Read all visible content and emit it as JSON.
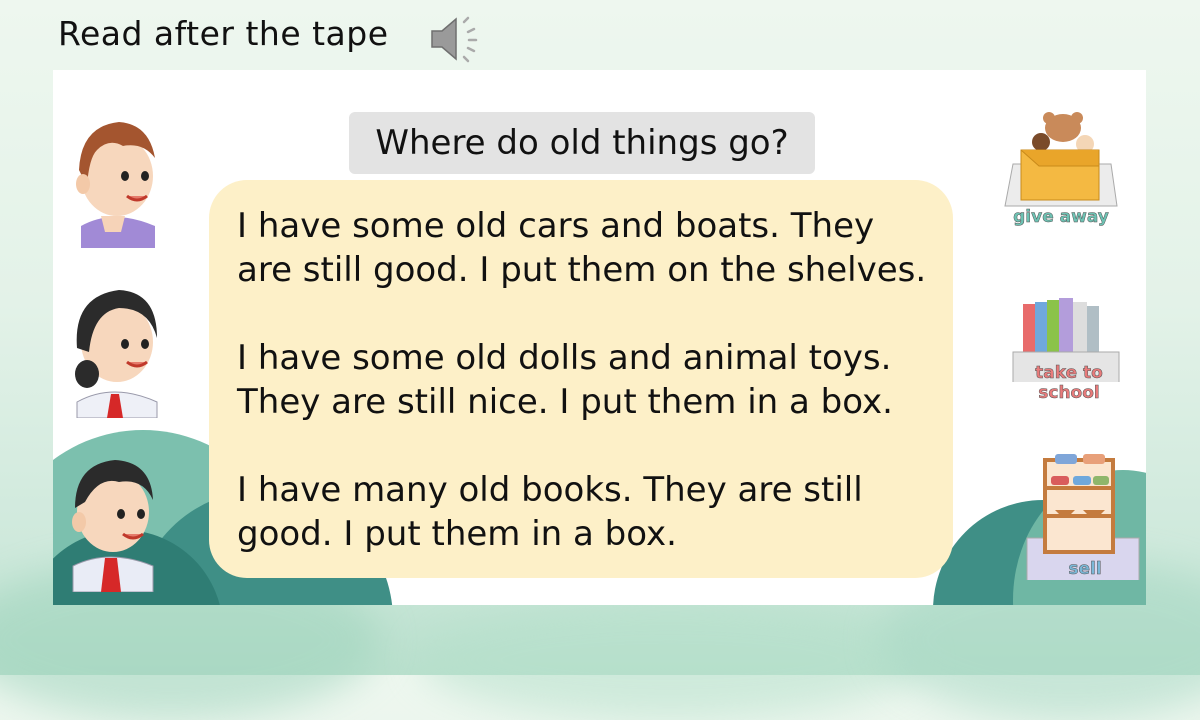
{
  "header": {
    "title": "Read after the tape"
  },
  "icons": {
    "speaker": "speaker-icon"
  },
  "slide": {
    "question": "Where do old things go?",
    "paragraphs": [
      {
        "line1": "I have some old cars and boats. They",
        "line2": "are still good. I put them on the shelves."
      },
      {
        "line1": "I have some old dolls and animal toys.",
        "line2": "They are still nice. I put them in a box."
      },
      {
        "line1": "I have many old books. They are still",
        "line2": "good. I put them in a box."
      }
    ],
    "items": [
      {
        "label": "give away"
      },
      {
        "label_line1": "take to",
        "label_line2": "school"
      },
      {
        "label": "sell"
      }
    ]
  },
  "colors": {
    "bubble": "#fdf0c8",
    "question_bg": "#e3e3e3",
    "background": "#e3f2e8",
    "hill_dark": "#3f8f86",
    "hill_light": "#7cc0ae"
  }
}
